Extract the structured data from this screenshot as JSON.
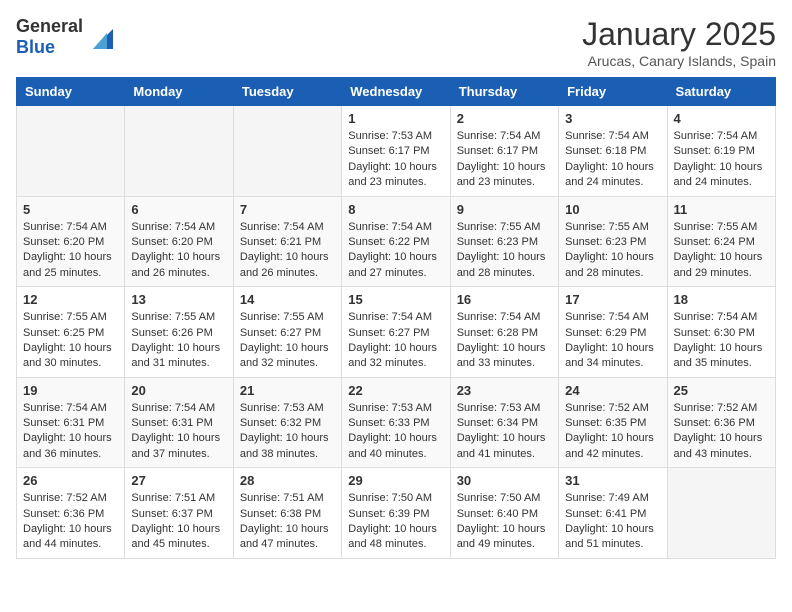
{
  "header": {
    "logo_general": "General",
    "logo_blue": "Blue",
    "month_year": "January 2025",
    "location": "Arucas, Canary Islands, Spain"
  },
  "weekdays": [
    "Sunday",
    "Monday",
    "Tuesday",
    "Wednesday",
    "Thursday",
    "Friday",
    "Saturday"
  ],
  "weeks": [
    [
      {
        "day": "",
        "content": ""
      },
      {
        "day": "",
        "content": ""
      },
      {
        "day": "",
        "content": ""
      },
      {
        "day": "1",
        "content": "Sunrise: 7:53 AM\nSunset: 6:17 PM\nDaylight: 10 hours\nand 23 minutes."
      },
      {
        "day": "2",
        "content": "Sunrise: 7:54 AM\nSunset: 6:17 PM\nDaylight: 10 hours\nand 23 minutes."
      },
      {
        "day": "3",
        "content": "Sunrise: 7:54 AM\nSunset: 6:18 PM\nDaylight: 10 hours\nand 24 minutes."
      },
      {
        "day": "4",
        "content": "Sunrise: 7:54 AM\nSunset: 6:19 PM\nDaylight: 10 hours\nand 24 minutes."
      }
    ],
    [
      {
        "day": "5",
        "content": "Sunrise: 7:54 AM\nSunset: 6:20 PM\nDaylight: 10 hours\nand 25 minutes."
      },
      {
        "day": "6",
        "content": "Sunrise: 7:54 AM\nSunset: 6:20 PM\nDaylight: 10 hours\nand 26 minutes."
      },
      {
        "day": "7",
        "content": "Sunrise: 7:54 AM\nSunset: 6:21 PM\nDaylight: 10 hours\nand 26 minutes."
      },
      {
        "day": "8",
        "content": "Sunrise: 7:54 AM\nSunset: 6:22 PM\nDaylight: 10 hours\nand 27 minutes."
      },
      {
        "day": "9",
        "content": "Sunrise: 7:55 AM\nSunset: 6:23 PM\nDaylight: 10 hours\nand 28 minutes."
      },
      {
        "day": "10",
        "content": "Sunrise: 7:55 AM\nSunset: 6:23 PM\nDaylight: 10 hours\nand 28 minutes."
      },
      {
        "day": "11",
        "content": "Sunrise: 7:55 AM\nSunset: 6:24 PM\nDaylight: 10 hours\nand 29 minutes."
      }
    ],
    [
      {
        "day": "12",
        "content": "Sunrise: 7:55 AM\nSunset: 6:25 PM\nDaylight: 10 hours\nand 30 minutes."
      },
      {
        "day": "13",
        "content": "Sunrise: 7:55 AM\nSunset: 6:26 PM\nDaylight: 10 hours\nand 31 minutes."
      },
      {
        "day": "14",
        "content": "Sunrise: 7:55 AM\nSunset: 6:27 PM\nDaylight: 10 hours\nand 32 minutes."
      },
      {
        "day": "15",
        "content": "Sunrise: 7:54 AM\nSunset: 6:27 PM\nDaylight: 10 hours\nand 32 minutes."
      },
      {
        "day": "16",
        "content": "Sunrise: 7:54 AM\nSunset: 6:28 PM\nDaylight: 10 hours\nand 33 minutes."
      },
      {
        "day": "17",
        "content": "Sunrise: 7:54 AM\nSunset: 6:29 PM\nDaylight: 10 hours\nand 34 minutes."
      },
      {
        "day": "18",
        "content": "Sunrise: 7:54 AM\nSunset: 6:30 PM\nDaylight: 10 hours\nand 35 minutes."
      }
    ],
    [
      {
        "day": "19",
        "content": "Sunrise: 7:54 AM\nSunset: 6:31 PM\nDaylight: 10 hours\nand 36 minutes."
      },
      {
        "day": "20",
        "content": "Sunrise: 7:54 AM\nSunset: 6:31 PM\nDaylight: 10 hours\nand 37 minutes."
      },
      {
        "day": "21",
        "content": "Sunrise: 7:53 AM\nSunset: 6:32 PM\nDaylight: 10 hours\nand 38 minutes."
      },
      {
        "day": "22",
        "content": "Sunrise: 7:53 AM\nSunset: 6:33 PM\nDaylight: 10 hours\nand 40 minutes."
      },
      {
        "day": "23",
        "content": "Sunrise: 7:53 AM\nSunset: 6:34 PM\nDaylight: 10 hours\nand 41 minutes."
      },
      {
        "day": "24",
        "content": "Sunrise: 7:52 AM\nSunset: 6:35 PM\nDaylight: 10 hours\nand 42 minutes."
      },
      {
        "day": "25",
        "content": "Sunrise: 7:52 AM\nSunset: 6:36 PM\nDaylight: 10 hours\nand 43 minutes."
      }
    ],
    [
      {
        "day": "26",
        "content": "Sunrise: 7:52 AM\nSunset: 6:36 PM\nDaylight: 10 hours\nand 44 minutes."
      },
      {
        "day": "27",
        "content": "Sunrise: 7:51 AM\nSunset: 6:37 PM\nDaylight: 10 hours\nand 45 minutes."
      },
      {
        "day": "28",
        "content": "Sunrise: 7:51 AM\nSunset: 6:38 PM\nDaylight: 10 hours\nand 47 minutes."
      },
      {
        "day": "29",
        "content": "Sunrise: 7:50 AM\nSunset: 6:39 PM\nDaylight: 10 hours\nand 48 minutes."
      },
      {
        "day": "30",
        "content": "Sunrise: 7:50 AM\nSunset: 6:40 PM\nDaylight: 10 hours\nand 49 minutes."
      },
      {
        "day": "31",
        "content": "Sunrise: 7:49 AM\nSunset: 6:41 PM\nDaylight: 10 hours\nand 51 minutes."
      },
      {
        "day": "",
        "content": ""
      }
    ]
  ]
}
